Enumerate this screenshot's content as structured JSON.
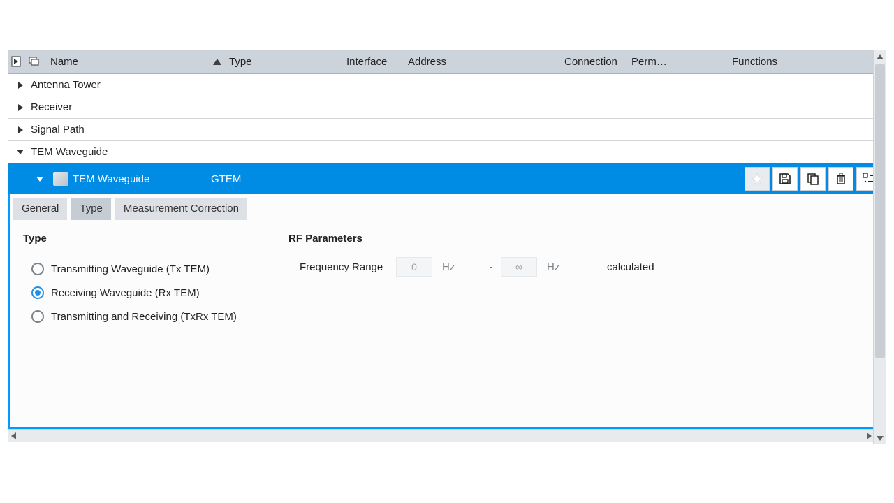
{
  "columns": {
    "name": "Name",
    "type": "Type",
    "interface": "Interface",
    "address": "Address",
    "connection": "Connection",
    "perm": "Perm…",
    "functions": "Functions"
  },
  "tree": {
    "items": [
      {
        "label": "Antenna Tower",
        "expanded": false
      },
      {
        "label": "Receiver",
        "expanded": false
      },
      {
        "label": "Signal Path",
        "expanded": false
      },
      {
        "label": "TEM Waveguide",
        "expanded": true
      }
    ]
  },
  "selected": {
    "name": "TEM Waveguide",
    "type": "GTEM"
  },
  "tabs": {
    "items": [
      {
        "label": "General",
        "active": false
      },
      {
        "label": "Type",
        "active": true
      },
      {
        "label": "Measurement Correction",
        "active": false
      }
    ]
  },
  "type_panel": {
    "heading": "Type",
    "options": [
      {
        "label": "Transmitting Waveguide (Tx TEM)",
        "selected": false
      },
      {
        "label": "Receiving Waveguide (Rx TEM)",
        "selected": true
      },
      {
        "label": "Transmitting and Receiving (TxRx TEM)",
        "selected": false
      }
    ]
  },
  "rf_panel": {
    "heading": "RF Parameters",
    "freq_label": "Frequency Range",
    "from_value": "0",
    "from_unit": "Hz",
    "dash": "-",
    "to_value": "∞",
    "to_unit": "Hz",
    "status": "calculated"
  },
  "toolbar_icons": [
    "star-icon",
    "save-icon",
    "copy-icon",
    "delete-icon",
    "configure-icon"
  ]
}
